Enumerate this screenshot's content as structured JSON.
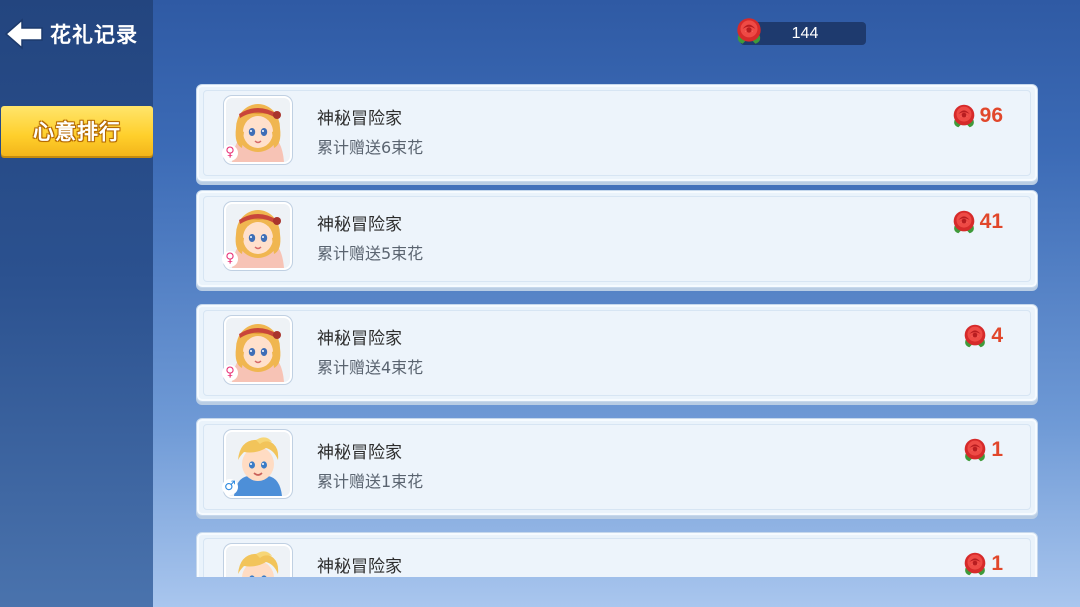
{
  "header": {
    "back_title": "花礼记录",
    "flower_count": "144"
  },
  "sidebar": {
    "tab_label": "心意排行"
  },
  "colors": {
    "accent_yellow": "#ffcf2b",
    "score_red": "#e1472b",
    "female": "#e8357a",
    "male": "#2f8be0"
  },
  "records": [
    {
      "name": "神秘冒险家",
      "desc": "累计赠送6束花",
      "score": "96",
      "gender": "♀",
      "avatar": "girl-avatar"
    },
    {
      "name": "神秘冒险家",
      "desc": "累计赠送5束花",
      "score": "41",
      "gender": "♀",
      "avatar": "girl-avatar"
    },
    {
      "name": "神秘冒险家",
      "desc": "累计赠送4束花",
      "score": "4",
      "gender": "♀",
      "avatar": "girl-avatar"
    },
    {
      "name": "神秘冒险家",
      "desc": "累计赠送1束花",
      "score": "1",
      "gender": "♂",
      "avatar": "boy-avatar"
    },
    {
      "name": "神秘冒险家",
      "desc": "",
      "score": "1",
      "gender": "",
      "avatar": "boy-avatar"
    }
  ]
}
